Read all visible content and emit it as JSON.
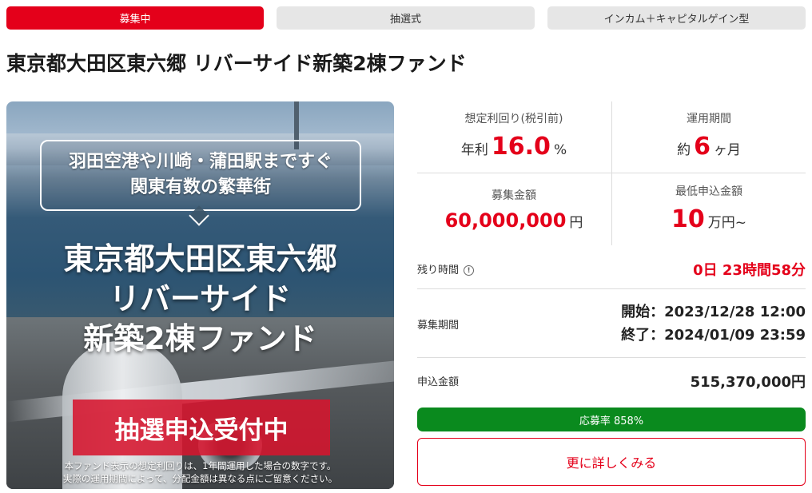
{
  "tags": [
    {
      "label": "募集中",
      "active": true
    },
    {
      "label": "抽選式",
      "active": false
    },
    {
      "label": "インカム＋キャピタルゲイン型",
      "active": false
    }
  ],
  "title": "東京都大田区東六郷 リバーサイド新築2棟ファンド",
  "hero": {
    "bubble_line1": "羽田空港や川崎・蒲田駅まですぐ",
    "bubble_line2": "関東有数の繁華街",
    "title_line1": "東京都大田区東六郷",
    "title_line2": "リバーサイド",
    "title_line3": "新築2棟ファンド",
    "badge": "抽選申込受付中",
    "note_line1": "本ファンド表示の想定利回りは、1年間運用した場合の数字です。",
    "note_line2": "実際の運用期間によって、分配金額は異なる点にご留意ください。"
  },
  "stats": {
    "yield": {
      "label": "想定利回り(税引前)",
      "prefix": "年利",
      "value": "16.0",
      "unit": "%"
    },
    "period": {
      "label": "運用期間",
      "prefix": "約",
      "value": "6",
      "unit": "ヶ月"
    },
    "amount": {
      "label": "募集金額",
      "value": "60,000,000",
      "unit": "円"
    },
    "min": {
      "label": "最低申込金額",
      "value": "10",
      "unit": "万円~"
    }
  },
  "remaining": {
    "label": "残り時間",
    "value": "0日 23時間58分"
  },
  "recruit_period": {
    "label": "募集期間",
    "start": "開始：2023/12/28 12:00",
    "end": "終了：2024/01/09 23:59"
  },
  "applied": {
    "label": "申込金額",
    "value": "515,370,000円"
  },
  "progress": {
    "label": "応募率 858%",
    "percent": 858
  },
  "more_button": "更に詳しくみる",
  "colors": {
    "accent": "#e4001a",
    "progress": "#0a8a1e"
  }
}
